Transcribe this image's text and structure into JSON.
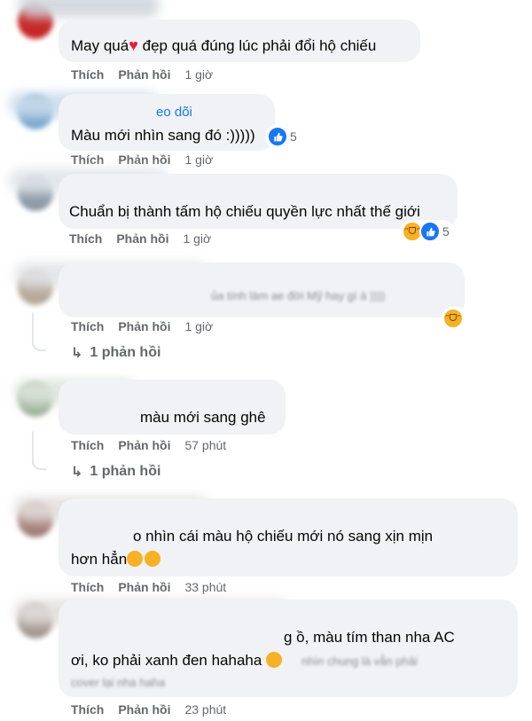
{
  "actions": {
    "like": "Thích",
    "reply": "Phản hồi"
  },
  "comments": [
    {
      "text": "May quá",
      "text2": "đẹp quá đúng lúc phải đổi hộ chiếu",
      "time": "1 giờ"
    },
    {
      "name_fragment": "eo dõi",
      "text": "Màu mới nhìn sang đó :)))))",
      "time": "1 giờ",
      "reaction_count": "5"
    },
    {
      "text": "Chuẩn bị thành tấm hộ chiếu quyền lực nhất thế giới",
      "time": "1 giờ",
      "reaction_count": "5"
    },
    {
      "blurred_text": "ủa tính làm ae đời Mỹ hay gì á ))))",
      "time": "1 giờ",
      "replies": "1 phản hồi"
    },
    {
      "text": "màu mới sang ghê",
      "time": "57 phút",
      "replies": "1 phản hồi"
    },
    {
      "text": "o nhìn cái màu hộ chiếu mới nó sang xịn mịn",
      "text2": "hơn hẳn",
      "time": "33 phút"
    },
    {
      "text": "g ồ, màu tím than nha AC",
      "text2": "ơi, ko phải xanh đen hahaha",
      "blurred_text": "nhìn chung là vẫn phải",
      "blurred_text2": "cover lại nha haha",
      "time": "23 phút"
    }
  ],
  "colors": {
    "like_blue": "#1877f2",
    "bubble": "#f0f2f5",
    "muted": "#65676b"
  }
}
